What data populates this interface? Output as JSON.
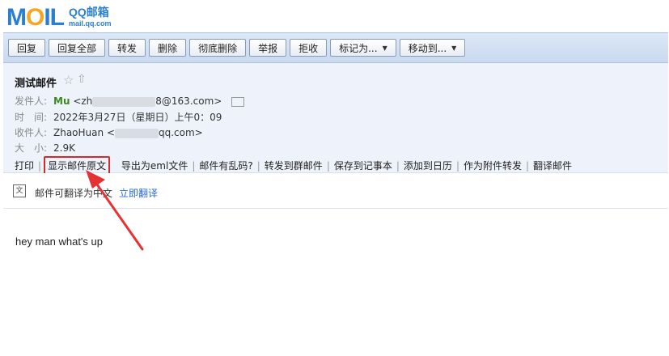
{
  "logo": {
    "brand": "MOIL",
    "name": "QQ邮箱",
    "domain": "mail.qq.com"
  },
  "toolbar": {
    "reply": "回复",
    "reply_all": "回复全部",
    "forward": "转发",
    "delete": "删除",
    "delete_permanently": "彻底删除",
    "report": "举报",
    "reject": "拒收",
    "mark_as": "标记为...",
    "move_to": "移动到..."
  },
  "mail": {
    "subject": "测试邮件",
    "from_label": "发件人:",
    "from_name": "Mu",
    "from_addr_prefix": "<zh",
    "from_addr_suffix": "8@163.com>",
    "time_label": "时　间:",
    "time_value": "2022年3月27日（星期日）上午0：09",
    "to_label": "收件人:",
    "to_name": "ZhaoHuan",
    "to_addr_prefix": "<",
    "to_addr_suffix": "qq.com>",
    "size_label": "大　小:",
    "size_value": "2.9K"
  },
  "actions": {
    "print": "打印",
    "show_source": "显示邮件原文",
    "export_eml": "导出为eml文件",
    "garbled": "邮件有乱码?",
    "forward_group": "转发到群邮件",
    "save_note": "保存到记事本",
    "add_calendar": "添加到日历",
    "forward_attachment": "作为附件转发",
    "translate_mail": "翻译邮件"
  },
  "translate_bar": {
    "icon": "translate-icon",
    "text": "邮件可翻译为中文",
    "link": "立即翻译"
  },
  "body": {
    "text": "hey man what's up"
  },
  "colors": {
    "highlight": "#d32a2a",
    "link": "#2a6ccf",
    "sender": "#3a8a1e"
  }
}
